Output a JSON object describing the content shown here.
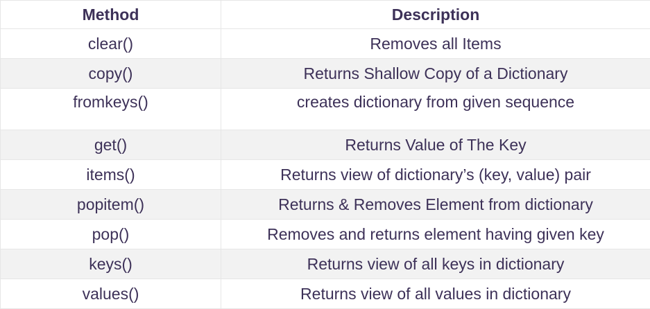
{
  "table": {
    "headers": [
      "Method",
      "Description"
    ],
    "rows": [
      {
        "method": "clear()",
        "description": "Removes all Items"
      },
      {
        "method": "copy()",
        "description": "Returns Shallow Copy of a Dictionary"
      },
      {
        "method": "fromkeys()",
        "description": "creates dictionary from given sequence"
      },
      {
        "method": "get()",
        "description": "Returns Value of The Key"
      },
      {
        "method": "items()",
        "description": "Returns view of dictionary’s (key, value) pair"
      },
      {
        "method": "popitem()",
        "description": "Returns & Removes Element from dictionary"
      },
      {
        "method": "pop()",
        "description": "Removes and returns element having given key"
      },
      {
        "method": "keys()",
        "description": "Returns view of all keys in dictionary"
      },
      {
        "method": "values()",
        "description": "Returns view of all values in dictionary"
      }
    ]
  },
  "colors": {
    "text": "#3d3158",
    "stripe": "#f2f2f2",
    "border": "#e6e6e6"
  }
}
